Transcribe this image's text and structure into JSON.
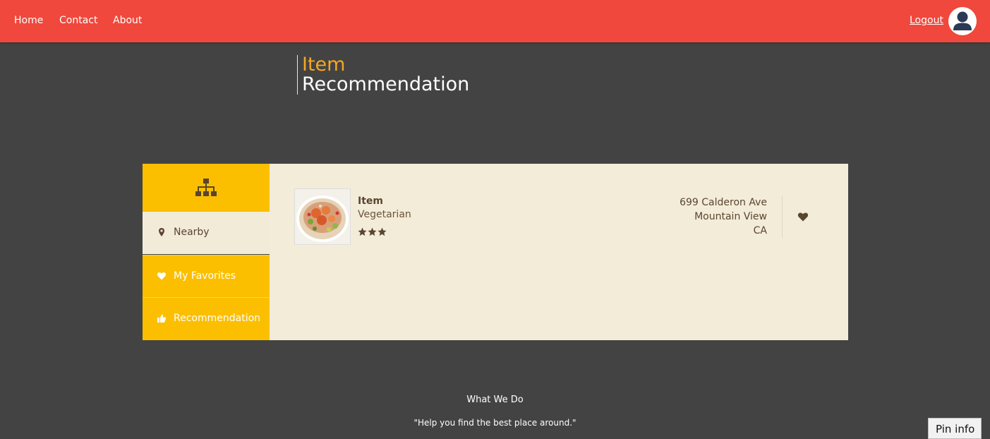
{
  "nav": {
    "home": "Home",
    "contact": "Contact",
    "about": "About",
    "logout": "Logout"
  },
  "heading": {
    "line1": "Item",
    "line2": "Recommendation"
  },
  "sidebar": {
    "items": [
      {
        "label": "Nearby",
        "icon": "map-marker-icon"
      },
      {
        "label": "My Favorites",
        "icon": "heart-icon"
      },
      {
        "label": "Recommendation",
        "icon": "thumbs-up-icon"
      }
    ]
  },
  "result": {
    "name": "Item",
    "category": "Vegetarian",
    "rating": 3,
    "address": {
      "street": "699 Calderon Ave",
      "city": "Mountain View",
      "state": "CA"
    }
  },
  "footer": {
    "title": "What We Do",
    "quote": "\"Help you find the best place around.\""
  },
  "pin_info": "Pin info",
  "colors": {
    "nav_bg": "#f0483c",
    "page_bg": "#434343",
    "accent": "#fbbf00",
    "title_accent": "#f5a623",
    "panel_bg": "#f3ecd8",
    "text_brown": "#5a4530"
  }
}
